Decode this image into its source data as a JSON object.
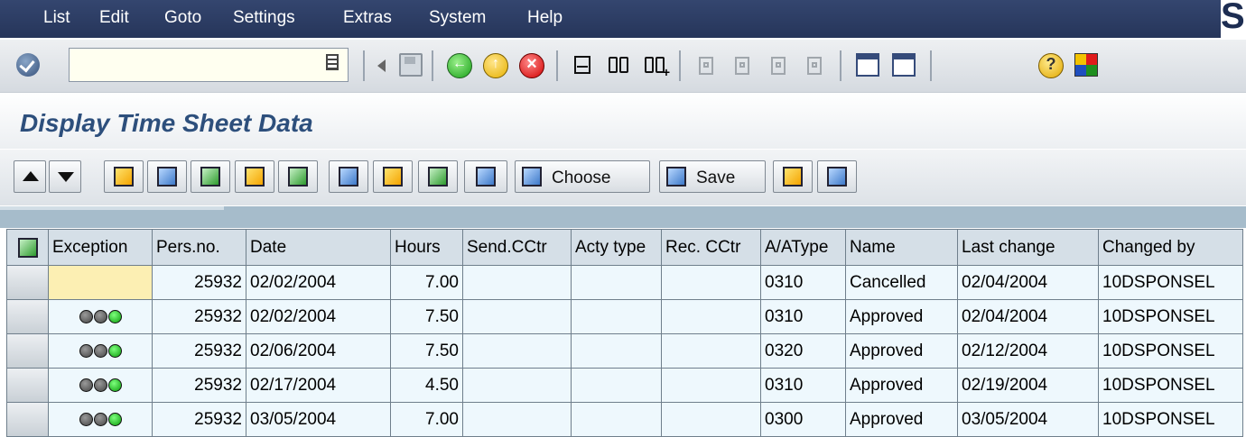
{
  "menu": [
    "List",
    "Edit",
    "Goto",
    "Settings",
    "Extras",
    "System",
    "Help"
  ],
  "logo_text": "S",
  "command_field": {
    "value": ""
  },
  "page_title": "Display Time Sheet Data",
  "toolbar": {
    "choose_label": "Choose",
    "save_label": "Save"
  },
  "findnext_glyph": "+",
  "columns": [
    "Exception",
    "Pers.no.",
    "Date",
    "Hours",
    "Send.CCtr",
    "Acty type",
    "Rec. CCtr",
    "A/AType",
    "Name",
    "Last change",
    "Changed by"
  ],
  "rows": [
    {
      "exception": "",
      "pers_no": "25932",
      "date": "02/02/2004",
      "hours": "7.00",
      "send_cctr": "",
      "acty_type": "",
      "rec_cctr": "",
      "aa_type": "0310",
      "name": "Cancelled",
      "last_change": "02/04/2004",
      "changed_by": "10DSPONSEL"
    },
    {
      "exception": "green",
      "pers_no": "25932",
      "date": "02/02/2004",
      "hours": "7.50",
      "send_cctr": "",
      "acty_type": "",
      "rec_cctr": "",
      "aa_type": "0310",
      "name": "Approved",
      "last_change": "02/04/2004",
      "changed_by": "10DSPONSEL"
    },
    {
      "exception": "green",
      "pers_no": "25932",
      "date": "02/06/2004",
      "hours": "7.50",
      "send_cctr": "",
      "acty_type": "",
      "rec_cctr": "",
      "aa_type": "0320",
      "name": "Approved",
      "last_change": "02/12/2004",
      "changed_by": "10DSPONSEL"
    },
    {
      "exception": "green",
      "pers_no": "25932",
      "date": "02/17/2004",
      "hours": "4.50",
      "send_cctr": "",
      "acty_type": "",
      "rec_cctr": "",
      "aa_type": "0310",
      "name": "Approved",
      "last_change": "02/19/2004",
      "changed_by": "10DSPONSEL"
    },
    {
      "exception": "green",
      "pers_no": "25932",
      "date": "03/05/2004",
      "hours": "7.00",
      "send_cctr": "",
      "acty_type": "",
      "rec_cctr": "",
      "aa_type": "0300",
      "name": "Approved",
      "last_change": "03/05/2004",
      "changed_by": "10DSPONSEL"
    }
  ],
  "colors": {
    "menubar": "#2b3b63",
    "title": "#2d4f7c",
    "grid_header": "#d5dfe7",
    "grid_cell": "#eef8fd",
    "exception_empty": "#fcefb3",
    "light_green": "#0a9b0a"
  }
}
